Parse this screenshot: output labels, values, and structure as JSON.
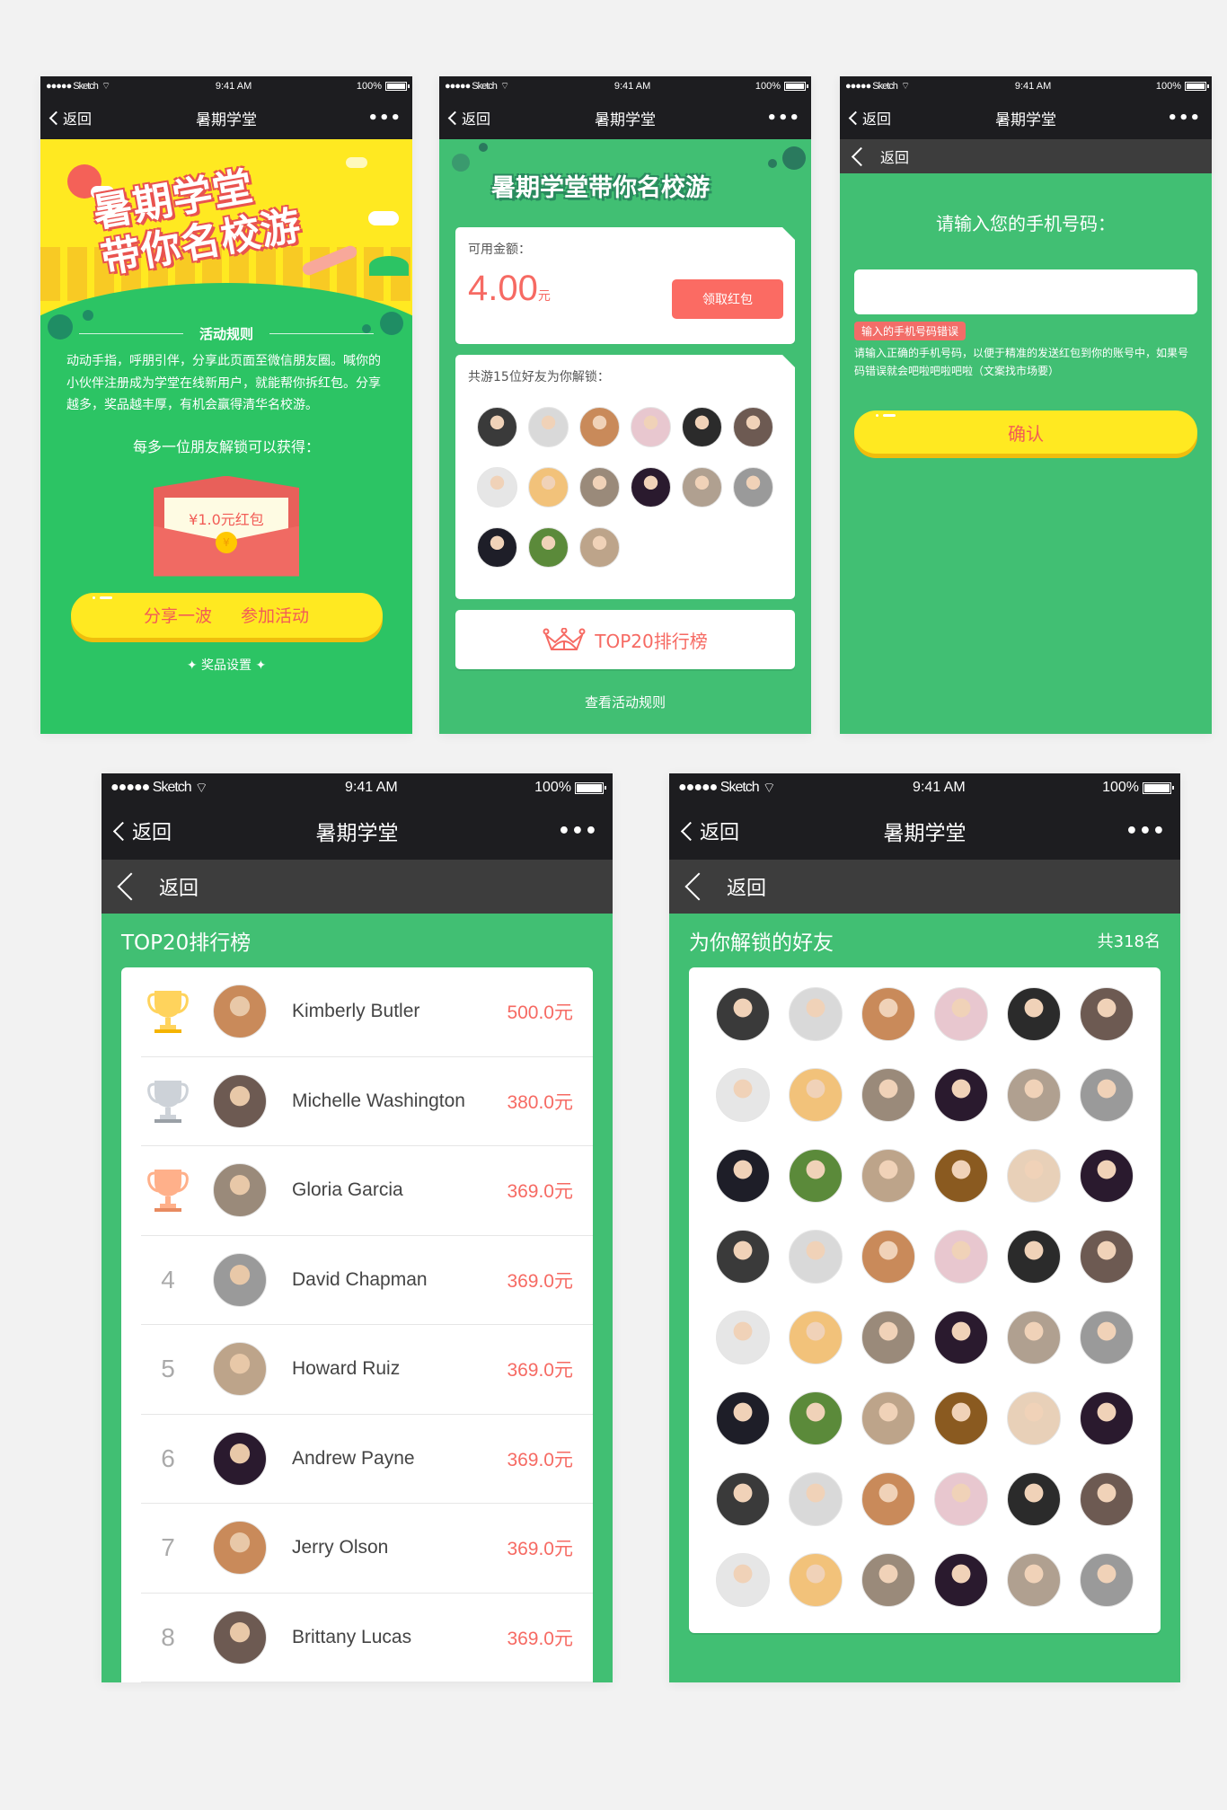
{
  "status_bar": {
    "carrier": "●●●●● Sketch",
    "time": "9:41 AM",
    "battery": "100%"
  },
  "nav": {
    "back_label": "返回",
    "title": "暑期学堂",
    "more": "•••"
  },
  "subnav": {
    "back_label": "返回"
  },
  "colors": {
    "green": "#41bf73",
    "banner_green": "#2cc464",
    "yellow": "#ffe921",
    "red": "#f66a63",
    "dark": "#1d1d20",
    "subbar": "#3d3d3d"
  },
  "screen1": {
    "banner_title_line1": "暑期学堂",
    "banner_title_line2": "带你名校游",
    "rules_title": "活动规则",
    "rules_text": "动动手指，呼朋引伴，分享此页面至微信朋友圈。喊你的小伙伴注册成为学堂在线新用户，就能帮你拆红包。分享越多，奖品越丰厚，有机会赢得清华名校游。",
    "reward_title": "每多一位朋友解锁可以获得：",
    "red_packet_label": "¥1.0元红包",
    "coin_symbol": "¥",
    "share_label": "分享一波",
    "join_label": "参加活动",
    "prize_link": "✦ 奖品设置 ✦"
  },
  "screen2": {
    "header_title": "暑期学堂带你名校游",
    "balance_label": "可用金额：",
    "balance_amount": "4.00",
    "balance_unit": "元",
    "claim_button": "领取红包",
    "friends_label": "共游15位好友为你解锁：",
    "friend_count": 15,
    "top20_label": "TOP20排行榜",
    "rules_link": "查看活动规则"
  },
  "screen3": {
    "phone_label": "请输入您的手机号码：",
    "phone_value": "",
    "error_badge": "输入的手机号码错误",
    "help_text": "请输入正确的手机号码，以便于精准的发送红包到你的账号中，如果号码错误就会吧啦吧啦吧啦（文案找市场要）",
    "confirm_label": "确认"
  },
  "screen4": {
    "section_title": "TOP20排行榜",
    "ranking": [
      {
        "rank": "1",
        "medal": "gold",
        "name": "Kimberly Butler",
        "amount": "500.0元"
      },
      {
        "rank": "2",
        "medal": "silver",
        "name": "Michelle Washington",
        "amount": "380.0元"
      },
      {
        "rank": "3",
        "medal": "bronze",
        "name": "Gloria Garcia",
        "amount": "369.0元"
      },
      {
        "rank": "4",
        "medal": "",
        "name": "David Chapman",
        "amount": "369.0元"
      },
      {
        "rank": "5",
        "medal": "",
        "name": "Howard Ruiz",
        "amount": "369.0元"
      },
      {
        "rank": "6",
        "medal": "",
        "name": "Andrew Payne",
        "amount": "369.0元"
      },
      {
        "rank": "7",
        "medal": "",
        "name": "Jerry Olson",
        "amount": "369.0元"
      },
      {
        "rank": "8",
        "medal": "",
        "name": "Brittany Lucas",
        "amount": "369.0元"
      }
    ]
  },
  "screen5": {
    "section_title": "为你解锁的好友",
    "count_label": "共318名",
    "visible_avatar_count": 48
  },
  "avatar_palette": [
    "#3a3a3a",
    "#d9d9d9",
    "#c98a5a",
    "#e8c7cf",
    "#2b2b2b",
    "#6d5a52",
    "#e6e6e6",
    "#f2c27a",
    "#9a8a7a",
    "#2a1a2e",
    "#b0a090",
    "#9a9a9a",
    "#1e1e28",
    "#5b8a3a",
    "#bda48a",
    "#8a5a20",
    "#e8d0b8",
    "#2a1a2e"
  ]
}
